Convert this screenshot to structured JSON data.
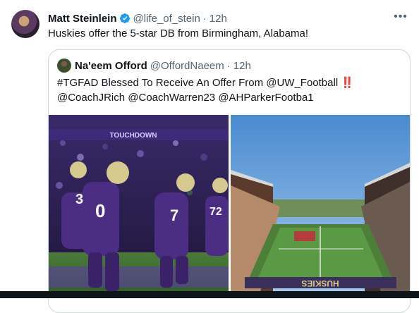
{
  "tweet": {
    "author_name": "Matt Steinlein",
    "handle": "@life_of_stein",
    "separator": "·",
    "time": "12h",
    "text": "Huskies offer the 5-star DB from Birmingham, Alabama!",
    "more_icon": "more-horizontal-icon",
    "verified_icon": "verified-badge-icon"
  },
  "quote": {
    "author_name": "Na'eem Offord",
    "handle": "@OffordNaeem",
    "separator": "·",
    "time": "12h",
    "line1": "#TGFAD Blessed To Receive An Offer From @UW_Football",
    "bangs": "‼️",
    "line2": "@CoachJRich  @CoachWarren23 @AHParkerFootba1"
  },
  "media": {
    "left_image": {
      "banner": "TOUCHDOWN",
      "jersey_numbers": [
        "3",
        "0",
        "7",
        "72"
      ]
    },
    "right_image": {
      "endzone_text": "HUSKIES"
    }
  },
  "colors": {
    "accent_blue": "#1d9bf0",
    "husky_purple": "#4b2e83",
    "text_secondary": "#536471",
    "border": "#cfd9de"
  }
}
